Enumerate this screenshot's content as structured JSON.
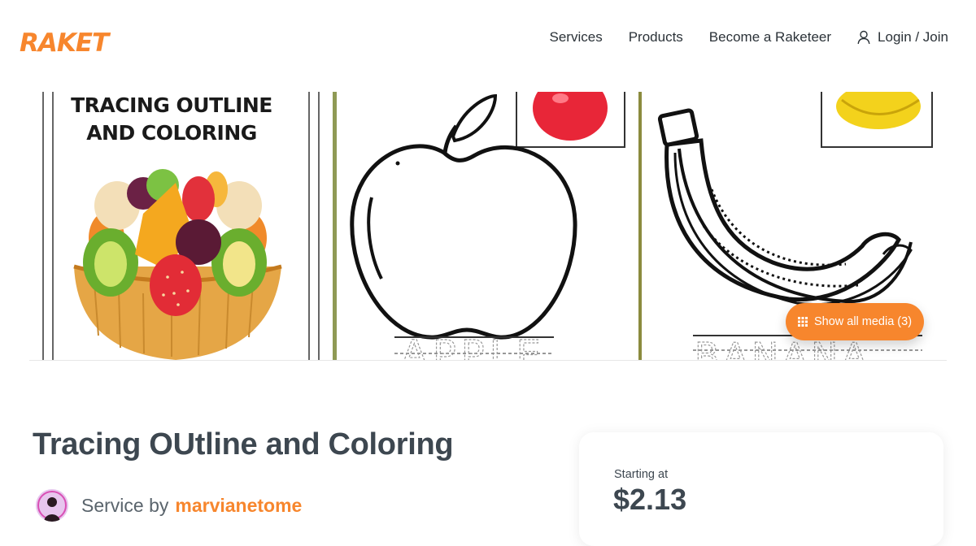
{
  "brand": {
    "name": "RAKET",
    "color": "#f7862d"
  },
  "nav": {
    "services": "Services",
    "products": "Products",
    "become": "Become a Raketeer",
    "login": "Login / Join"
  },
  "gallery": {
    "panel1_title": "TRACING OUTLINE AND COLORING",
    "panel2_word": "APPLE",
    "panel3_word": "BANANA",
    "show_all_media": "Show all media (3)"
  },
  "service": {
    "title": "Tracing OUtline and Coloring",
    "service_by": "Service by",
    "seller": "marvianetome"
  },
  "pricing": {
    "starting_at": "Starting at",
    "price": "$2.13"
  },
  "icons": [
    "user-icon",
    "grid-icon",
    "apple-image",
    "banana-image",
    "fruit-tart-image"
  ]
}
